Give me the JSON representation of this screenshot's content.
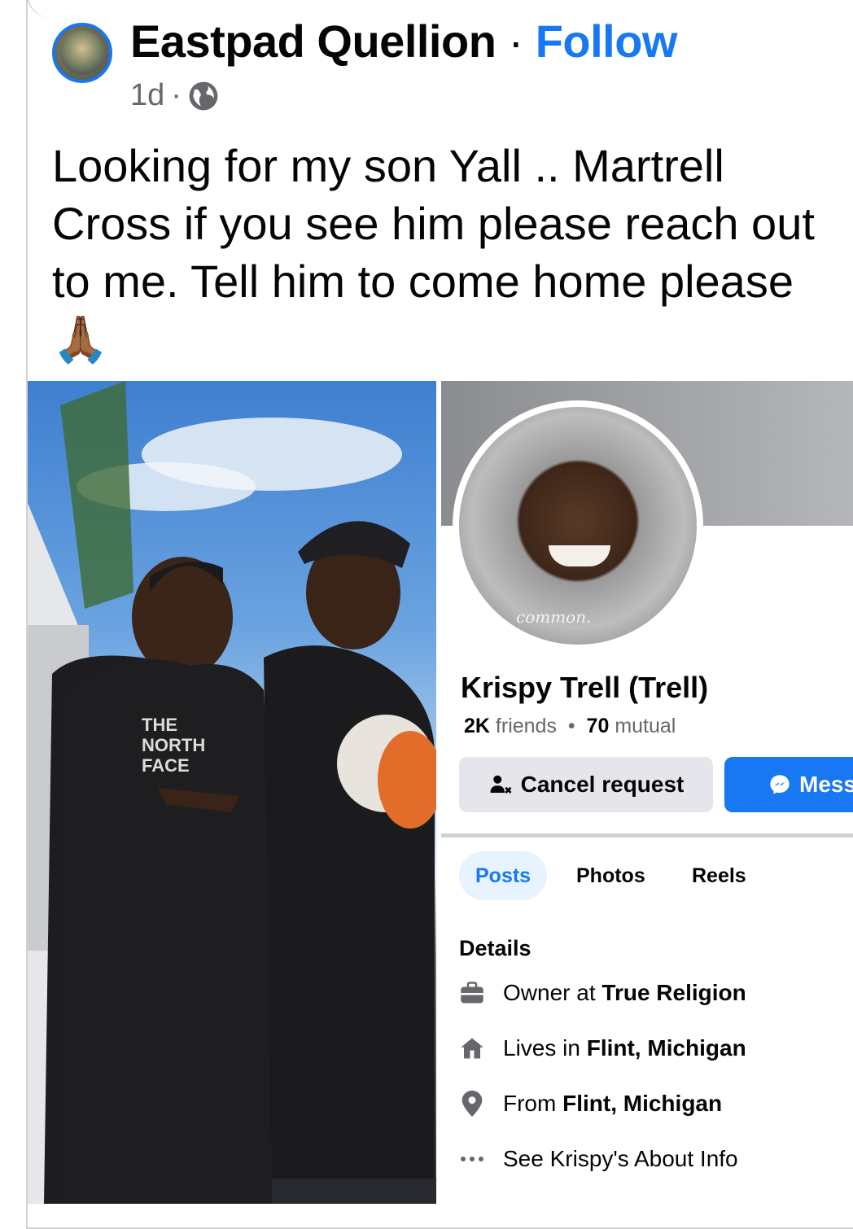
{
  "post": {
    "author": "Eastpad Quellion",
    "separator": "·",
    "follow_label": "Follow",
    "time": "1d",
    "meta_sep": "·",
    "audience_icon": "globe-icon",
    "text": "Looking for my son Yall .. Martrell Cross if you see him please reach out to me. Tell him to come home please",
    "emoji": "🙏🏾"
  },
  "profile": {
    "watermark": "common.",
    "name": "Krispy Trell (Trell)",
    "friends_count": "2K",
    "friends_label": "friends",
    "stats_sep": "•",
    "mutual_count": "70",
    "mutual_label": "mutual",
    "cancel_label": "Cancel request",
    "message_label": "Mess",
    "tabs": [
      "Posts",
      "Photos",
      "Reels"
    ],
    "details_heading": "Details",
    "details": [
      {
        "icon": "briefcase-icon",
        "prefix": "Owner at ",
        "value": "True Religion"
      },
      {
        "icon": "home-icon",
        "prefix": "Lives in ",
        "value": "Flint, Michigan"
      },
      {
        "icon": "location-pin-icon",
        "prefix": "From ",
        "value": "Flint, Michigan"
      },
      {
        "icon": "more-dots-icon",
        "prefix": "See Krispy's About Info",
        "value": ""
      }
    ]
  },
  "colors": {
    "accent": "#1877f2",
    "muted_text": "#65676b",
    "button_gray": "#e4e6eb",
    "tab_active_bg": "#e7f3ff"
  }
}
